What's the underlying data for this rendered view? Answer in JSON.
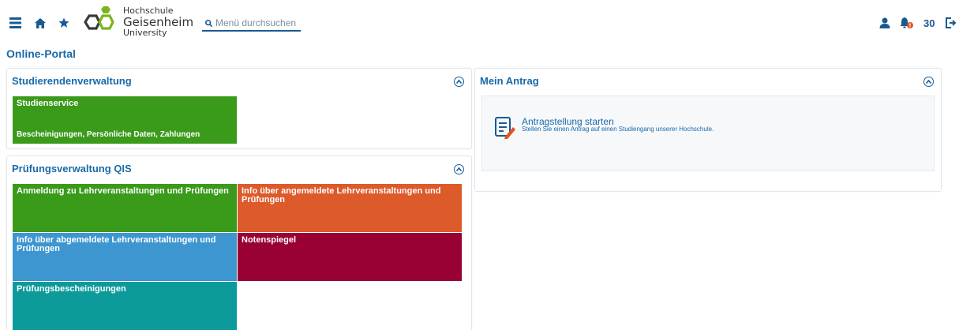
{
  "header": {
    "logo": {
      "line1": "Hochschule",
      "line2": "Geisenheim",
      "line3": "University"
    },
    "search": {
      "placeholder": "Menü durchsuchen"
    },
    "notification_count": "30"
  },
  "page": {
    "title": "Online-Portal"
  },
  "panels": {
    "studierendenverwaltung": {
      "title": "Studierendenverwaltung",
      "tiles": [
        {
          "title": "Studienservice",
          "subtitle": "Bescheinigungen, Persönliche Daten, Zahlungen",
          "color": "#3a9a1a"
        }
      ]
    },
    "pruefungsverwaltung": {
      "title": "Prüfungsverwaltung QIS",
      "tiles": [
        {
          "title": "Anmeldung zu Lehrveranstaltungen und Prüfungen",
          "color": "#3a9a1a"
        },
        {
          "title": "Info über angemeldete Lehrveranstaltungen und Prüfungen",
          "color": "#dd5a2b"
        },
        {
          "title": "Info über abgemeldete Lehrveranstaltungen und Prüfungen",
          "color": "#3d96cf"
        },
        {
          "title": "Notenspiegel",
          "color": "#990033"
        },
        {
          "title": "Prüfungsbescheinigungen",
          "color": "#0d9a9a"
        }
      ]
    },
    "mein_antrag": {
      "title": "Mein Antrag",
      "action": {
        "label": "Antragstellung starten",
        "description": "Stellen Sie einen Antrag auf einen Studiengang unserer Hochschule."
      }
    }
  },
  "icons": {
    "menu": "menu-icon",
    "home": "home-icon",
    "favorites": "star-icon",
    "search": "search-icon",
    "user": "user-icon",
    "notifications": "bell-icon",
    "logout": "logout-icon",
    "collapse": "chevron-up-circle-icon",
    "form": "form-edit-icon"
  },
  "colors": {
    "accent": "#1a5a93",
    "link": "#1a6aa8"
  }
}
